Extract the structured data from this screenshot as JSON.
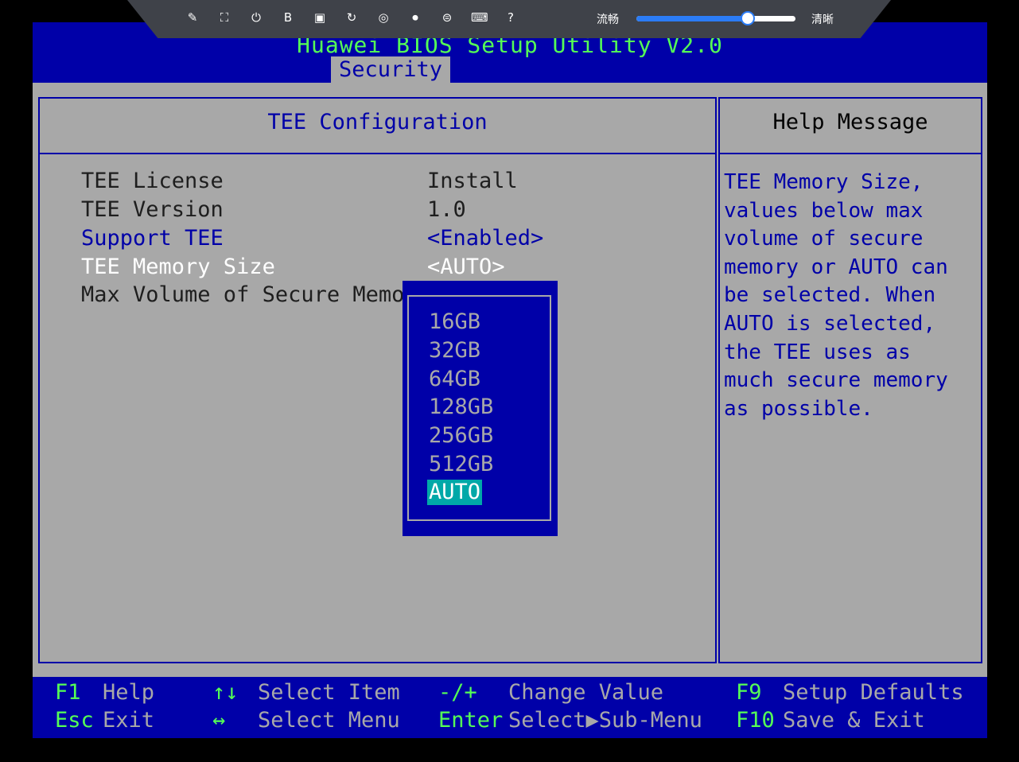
{
  "bios_title": "Huawei BIOS Setup Utility V2.0",
  "tab_security": "Security",
  "main_title": "TEE Configuration",
  "help_title": "Help Message",
  "items": [
    {
      "label": "TEE License",
      "value": "Install"
    },
    {
      "label": "TEE Version",
      "value": "1.0"
    },
    {
      "label": "Support TEE",
      "value": "<Enabled>"
    },
    {
      "label": "TEE Memory Size",
      "value": "<AUTO>"
    },
    {
      "label": "Max Volume of Secure Memory",
      "value": ""
    }
  ],
  "help_text": "TEE Memory Size,\nvalues below max\nvolume of secure\nmemory or AUTO can\nbe selected. When\nAUTO is selected,\nthe TEE uses as\nmuch secure memory\nas possible.",
  "popup_options": [
    "16GB",
    "32GB",
    "64GB",
    "128GB",
    "256GB",
    "512GB",
    "AUTO"
  ],
  "popup_selected": "AUTO",
  "footer": {
    "f1_key": "F1",
    "f1_desc": "Help",
    "esc_key": "Esc",
    "esc_desc": "Exit",
    "ud_key": "↑↓",
    "ud_desc": "Select Item",
    "lr_key": "↔",
    "lr_desc": "Select Menu",
    "pm_key": "-/+",
    "pm_desc": "Change Value",
    "enter_key": "Enter",
    "enter_desc": "Select▶Sub-Menu",
    "f9_key": "F9",
    "f9_desc": "Setup Defaults",
    "f10_key": "F10",
    "f10_desc": "Save & Exit"
  },
  "toolbar": {
    "icons": [
      "pin-icon",
      "fullscreen-icon",
      "power-icon",
      "boot-icon",
      "capture-icon",
      "mouse-icon",
      "disc-icon",
      "record-icon",
      "menu-icon",
      "keyboard-icon",
      "help-icon"
    ],
    "glyphs": [
      "✎",
      "⛶",
      "⏻",
      "B",
      "▣",
      "↻",
      "◎",
      "⏺",
      "⊜",
      "⌨",
      "?"
    ],
    "label_left": "流畅",
    "label_right": "清晰",
    "quality_level": 0.7
  },
  "colors": {
    "bios_blue": "#0000a8",
    "bios_gray": "#a8a8a8",
    "key_green": "#55ff55",
    "highlight": "#00a8a8"
  }
}
